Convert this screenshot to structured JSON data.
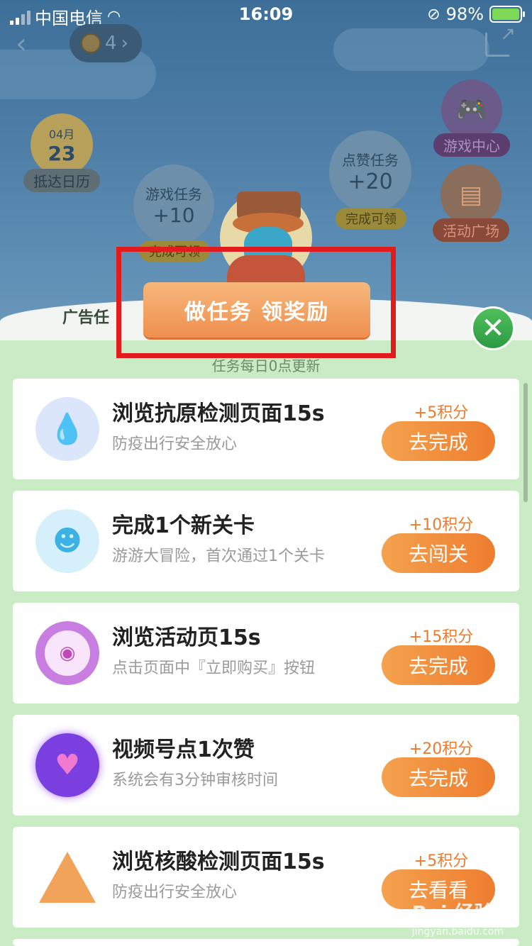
{
  "status_bar": {
    "carrier": "中国电信",
    "time": "16:09",
    "battery": "98%"
  },
  "header": {
    "coins": "4",
    "coin_arrow": "›"
  },
  "floats": {
    "calendar": {
      "month": "04月",
      "day": "23",
      "label": "抵达日历"
    },
    "game_center": {
      "label": "游戏中心"
    },
    "activity_square": {
      "label": "活动广场"
    },
    "like_task": {
      "title": "点赞任务",
      "value": "+20",
      "status": "完成可领"
    },
    "game_task": {
      "title": "游戏任务",
      "value": "+10",
      "status": "完成可领"
    },
    "left_partial": "广告任"
  },
  "banner": {
    "text": "做任务 领奖励"
  },
  "subtitle": "任务每日0点更新",
  "tasks": [
    {
      "title": "浏览抗原检测页面15s",
      "desc": "防疫出行安全放心",
      "points": "+5积分",
      "button": "去完成",
      "icon": "dropper-icon"
    },
    {
      "title": "完成1个新关卡",
      "desc": "游游大冒险，首次通过1个关卡",
      "points": "+10积分",
      "button": "去闯关",
      "icon": "mascot-icon"
    },
    {
      "title": "浏览活动页15s",
      "desc": "点击页面中『立即购买』按钮",
      "points": "+15积分",
      "button": "去完成",
      "icon": "eye-icon"
    },
    {
      "title": "视频号点1次赞",
      "desc": "系统会有3分钟审核时间",
      "points": "+20积分",
      "button": "去完成",
      "icon": "heart-icon"
    },
    {
      "title": "浏览核酸检测页面15s",
      "desc": "防疫出行安全放心",
      "points": "+5积分",
      "button": "去看看",
      "icon": "test-tube-icon"
    }
  ],
  "watermark": {
    "brand": "Bai 经验",
    "url": "jingyan.baidu.com"
  },
  "colors": {
    "accent_orange": "#ee7d2f",
    "highlight_red": "#e21c1c",
    "close_green": "#2d9b42"
  }
}
